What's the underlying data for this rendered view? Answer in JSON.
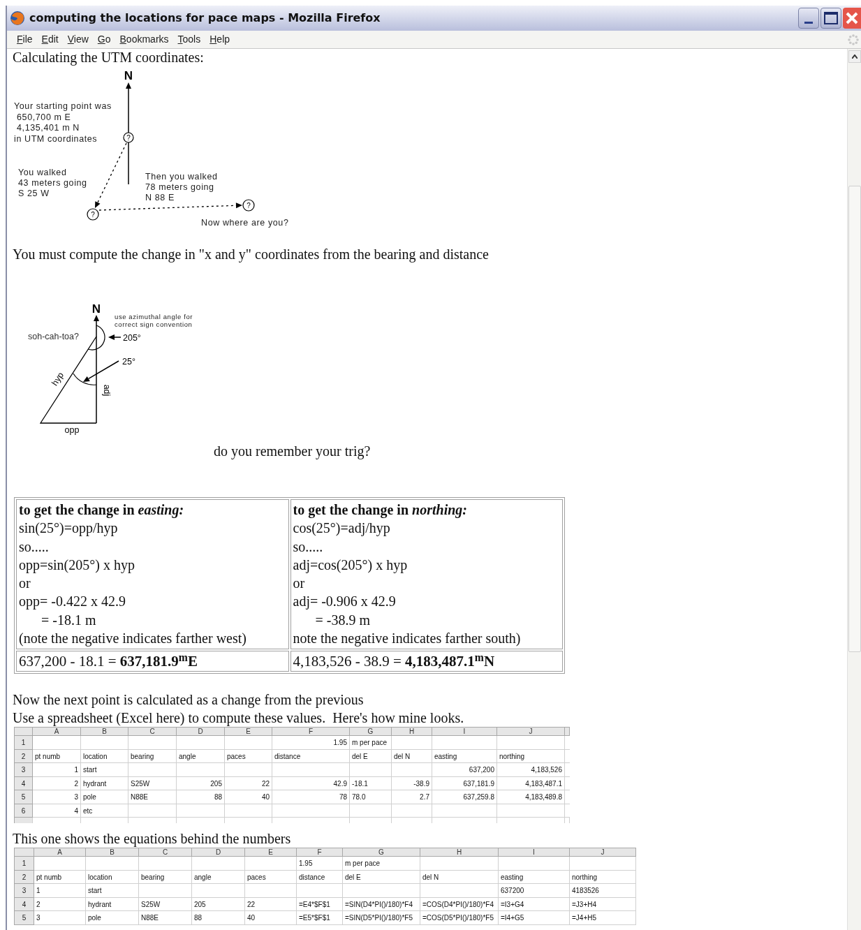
{
  "window": {
    "title": "computing the locations for pace maps - Mozilla Firefox"
  },
  "menu": [
    {
      "label": "File"
    },
    {
      "label": "Edit"
    },
    {
      "label": "View"
    },
    {
      "label": "Go"
    },
    {
      "label": "Bookmarks"
    },
    {
      "label": "Tools"
    },
    {
      "label": "Help"
    }
  ],
  "page": {
    "heading": "Calculating the UTM coordinates:",
    "walk_diagram": {
      "north": "N",
      "start_lines": [
        "Your starting point was",
        " 650,700 m E",
        " 4,135,401 m N",
        "in UTM coordinates"
      ],
      "leg1_lines": [
        "You walked",
        "43 meters going",
        "S 25 W"
      ],
      "leg2_lines": [
        "Then you walked",
        "78 meters going",
        "N 88 E"
      ],
      "question": "Now where are you?",
      "point_marks": [
        "?",
        "?",
        "?"
      ]
    },
    "intro": "You must compute the change in \"x and y\" coordinates from the bearing and distance",
    "trig_diagram": {
      "north": "N",
      "note_lines": [
        "use azimuthal angle for",
        "correct sign convention"
      ],
      "mnemonic": "soh-cah-toa?",
      "azimuth": "205°",
      "angle": "25°",
      "hyp": "hyp",
      "adj": "adj",
      "opp": "opp"
    },
    "trig_caption": "do you remember your trig?",
    "table": [
      {
        "lines": [
          {
            "kind": "heading",
            "text": "to get the change in *easting:*"
          },
          {
            "kind": "text",
            "text": "sin(25°)=opp/hyp"
          },
          {
            "kind": "text",
            "text": "so....."
          },
          {
            "kind": "text",
            "text": "opp=sin(205°) x hyp"
          },
          {
            "kind": "text",
            "text": "or"
          },
          {
            "kind": "text",
            "text": "opp= -0.422 x 42.9"
          },
          {
            "kind": "indented",
            "text": "= -18.1 m"
          },
          {
            "kind": "text",
            "text": "(note the negative indicates farther west)"
          }
        ],
        "result": "637,200 - 18.1 = **637,181.9**$^{m}$**E**"
      },
      {
        "lines": [
          {
            "kind": "heading",
            "text": "to get the change in *northing:*"
          },
          {
            "kind": "text",
            "text": "cos(25°)=adj/hyp"
          },
          {
            "kind": "text",
            "text": "so....."
          },
          {
            "kind": "text",
            "text": "adj=cos(205°) x hyp"
          },
          {
            "kind": "text",
            "text": "or"
          },
          {
            "kind": "text",
            "text": "adj= -0.906 x 42.9"
          },
          {
            "kind": "indented",
            "text": "= -38.9 m"
          },
          {
            "kind": "text",
            "text": "note the negative indicates farther south)"
          }
        ],
        "result": "4,183,526 - 38.9 = **4,183,487.1**$^{m}$**N**"
      }
    ],
    "sheets": [
      {
        "intro_lines": [
          "Now the next point is calculated as a change from the previous",
          "Use a spreadsheet (Excel here) to compute these values.  Here's how mine looks."
        ],
        "columns": [
          "A",
          "B",
          "C",
          "D",
          "E",
          "F",
          "G",
          "H",
          "I",
          "J"
        ],
        "rows": [
          {
            "number": "1",
            "cells": [
              null,
              null,
              null,
              null,
              null,
              {
                "text": "1.95",
                "kind": "number"
              },
              "m per pace",
              null,
              null,
              null
            ]
          },
          {
            "number": "2",
            "cells": [
              "pt numb",
              "location",
              "bearing",
              "angle",
              "paces",
              "distance",
              "del E",
              "del N",
              "easting",
              "northing"
            ]
          },
          {
            "number": "3",
            "cells": [
              {
                "text": "1",
                "kind": "number"
              },
              "start",
              null,
              null,
              null,
              null,
              null,
              null,
              {
                "text": "637,200",
                "kind": "number"
              },
              {
                "text": "4,183,526",
                "kind": "number"
              }
            ]
          },
          {
            "number": "4",
            "cells": [
              {
                "text": "2",
                "kind": "number"
              },
              "hydrant",
              "S25W",
              {
                "text": "205",
                "kind": "number"
              },
              {
                "text": "22",
                "kind": "number"
              },
              {
                "text": "42.9",
                "kind": "number"
              },
              "-18.1",
              {
                "text": "-38.9",
                "kind": "number"
              },
              {
                "text": "637,181.9",
                "kind": "number"
              },
              {
                "text": "4,183,487.1",
                "kind": "number"
              }
            ]
          },
          {
            "number": "5",
            "cells": [
              {
                "text": "3",
                "kind": "number"
              },
              "pole",
              "N88E",
              {
                "text": "88",
                "kind": "number"
              },
              {
                "text": "40",
                "kind": "number"
              },
              {
                "text": "78",
                "kind": "number"
              },
              "78.0",
              {
                "text": "2.7",
                "kind": "number"
              },
              {
                "text": "637,259.8",
                "kind": "number"
              },
              {
                "text": "4,183,489.8",
                "kind": "number"
              }
            ]
          },
          {
            "number": "6",
            "cells": [
              {
                "text": "4",
                "kind": "number"
              },
              "etc",
              null,
              null,
              null,
              null,
              null,
              null,
              null,
              null
            ]
          }
        ]
      },
      {
        "intro_lines": [
          "This one shows the equations behind the numbers"
        ],
        "columns": [
          "A",
          "B",
          "C",
          "D",
          "E",
          "F",
          "G",
          "H",
          "I",
          "J"
        ],
        "rows": [
          {
            "number": "1",
            "cells": [
              null,
              null,
              null,
              null,
              null,
              "1.95",
              "m per pace",
              null,
              null,
              null
            ]
          },
          {
            "number": "2",
            "cells": [
              "pt numb",
              "location",
              "bearing",
              "angle",
              "paces",
              "distance",
              "del E",
              "del N",
              "easting",
              "northing"
            ]
          },
          {
            "number": "3",
            "cells": [
              "1",
              "start",
              null,
              null,
              null,
              null,
              null,
              null,
              "637200",
              "4183526"
            ]
          },
          {
            "number": "4",
            "cells": [
              "2",
              "hydrant",
              "S25W",
              "205",
              "22",
              "=E4*$F$1",
              "=SIN(D4*PI()/180)*F4",
              "=COS(D4*PI()/180)*F4",
              "=I3+G4",
              "=J3+H4"
            ]
          },
          {
            "number": "5",
            "cells": [
              "3",
              "pole",
              "N88E",
              "88",
              "40",
              "=E5*$F$1",
              "=SIN(D5*PI()/180)*F5",
              "=COS(D5*PI()/180)*F5",
              "=I4+G5",
              "=J4+H5"
            ]
          }
        ]
      }
    ]
  }
}
